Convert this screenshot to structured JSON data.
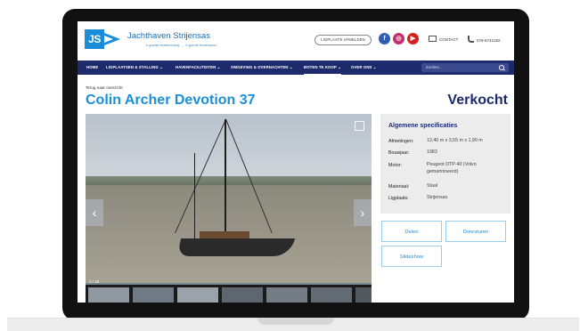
{
  "site": {
    "brand": "Jachthaven Strijensas",
    "tagline": "'n goede bestemming .... 'n goede thuishaven",
    "logo_text": "JS"
  },
  "header": {
    "ligplaats_button": "LIGPLAATS AFMELDEN",
    "social": [
      {
        "icon": "facebook-icon",
        "glyph": "f"
      },
      {
        "icon": "instagram-icon",
        "glyph": "◎"
      },
      {
        "icon": "youtube-icon",
        "glyph": "▶"
      }
    ],
    "contact_label": "CONTACT",
    "phone": "078-6742182"
  },
  "nav": {
    "items": [
      {
        "label": "HOME"
      },
      {
        "label": "LIGPLAATSEN & STALLING ⌄"
      },
      {
        "label": "HAVENFACILITEITEN ⌄"
      },
      {
        "label": "OMGEVING & OVERNACHTEN ⌄"
      },
      {
        "label": "BOTEN TE KOOP ⌄",
        "active": true
      },
      {
        "label": "OVER ONS ⌄"
      }
    ],
    "search_placeholder": "Zoeken..."
  },
  "page": {
    "back_link": "Terug naar overzicht",
    "title": "Colin Archer Devotion 37",
    "status": "Verkocht"
  },
  "gallery": {
    "counter": "1 / 26",
    "prev": "‹",
    "next": "›"
  },
  "specs": {
    "heading": "Algemene specificaties",
    "rows": [
      {
        "label": "Afmetingen:",
        "value": "12,40 m x 3,55 m x 1,90 m"
      },
      {
        "label": "Bouwjaar:",
        "value": "1983"
      },
      {
        "label": "Motor:",
        "value": "Peugeot DTP-40 (Volvo gemariniseerd)"
      },
      {
        "label": "Materiaal:",
        "value": "Staal"
      },
      {
        "label": "Ligplaats:",
        "value": "Strijensas"
      }
    ]
  },
  "actions": {
    "share": "Delen",
    "forward": "Doorsturen",
    "slideshow": "Slideshow"
  }
}
